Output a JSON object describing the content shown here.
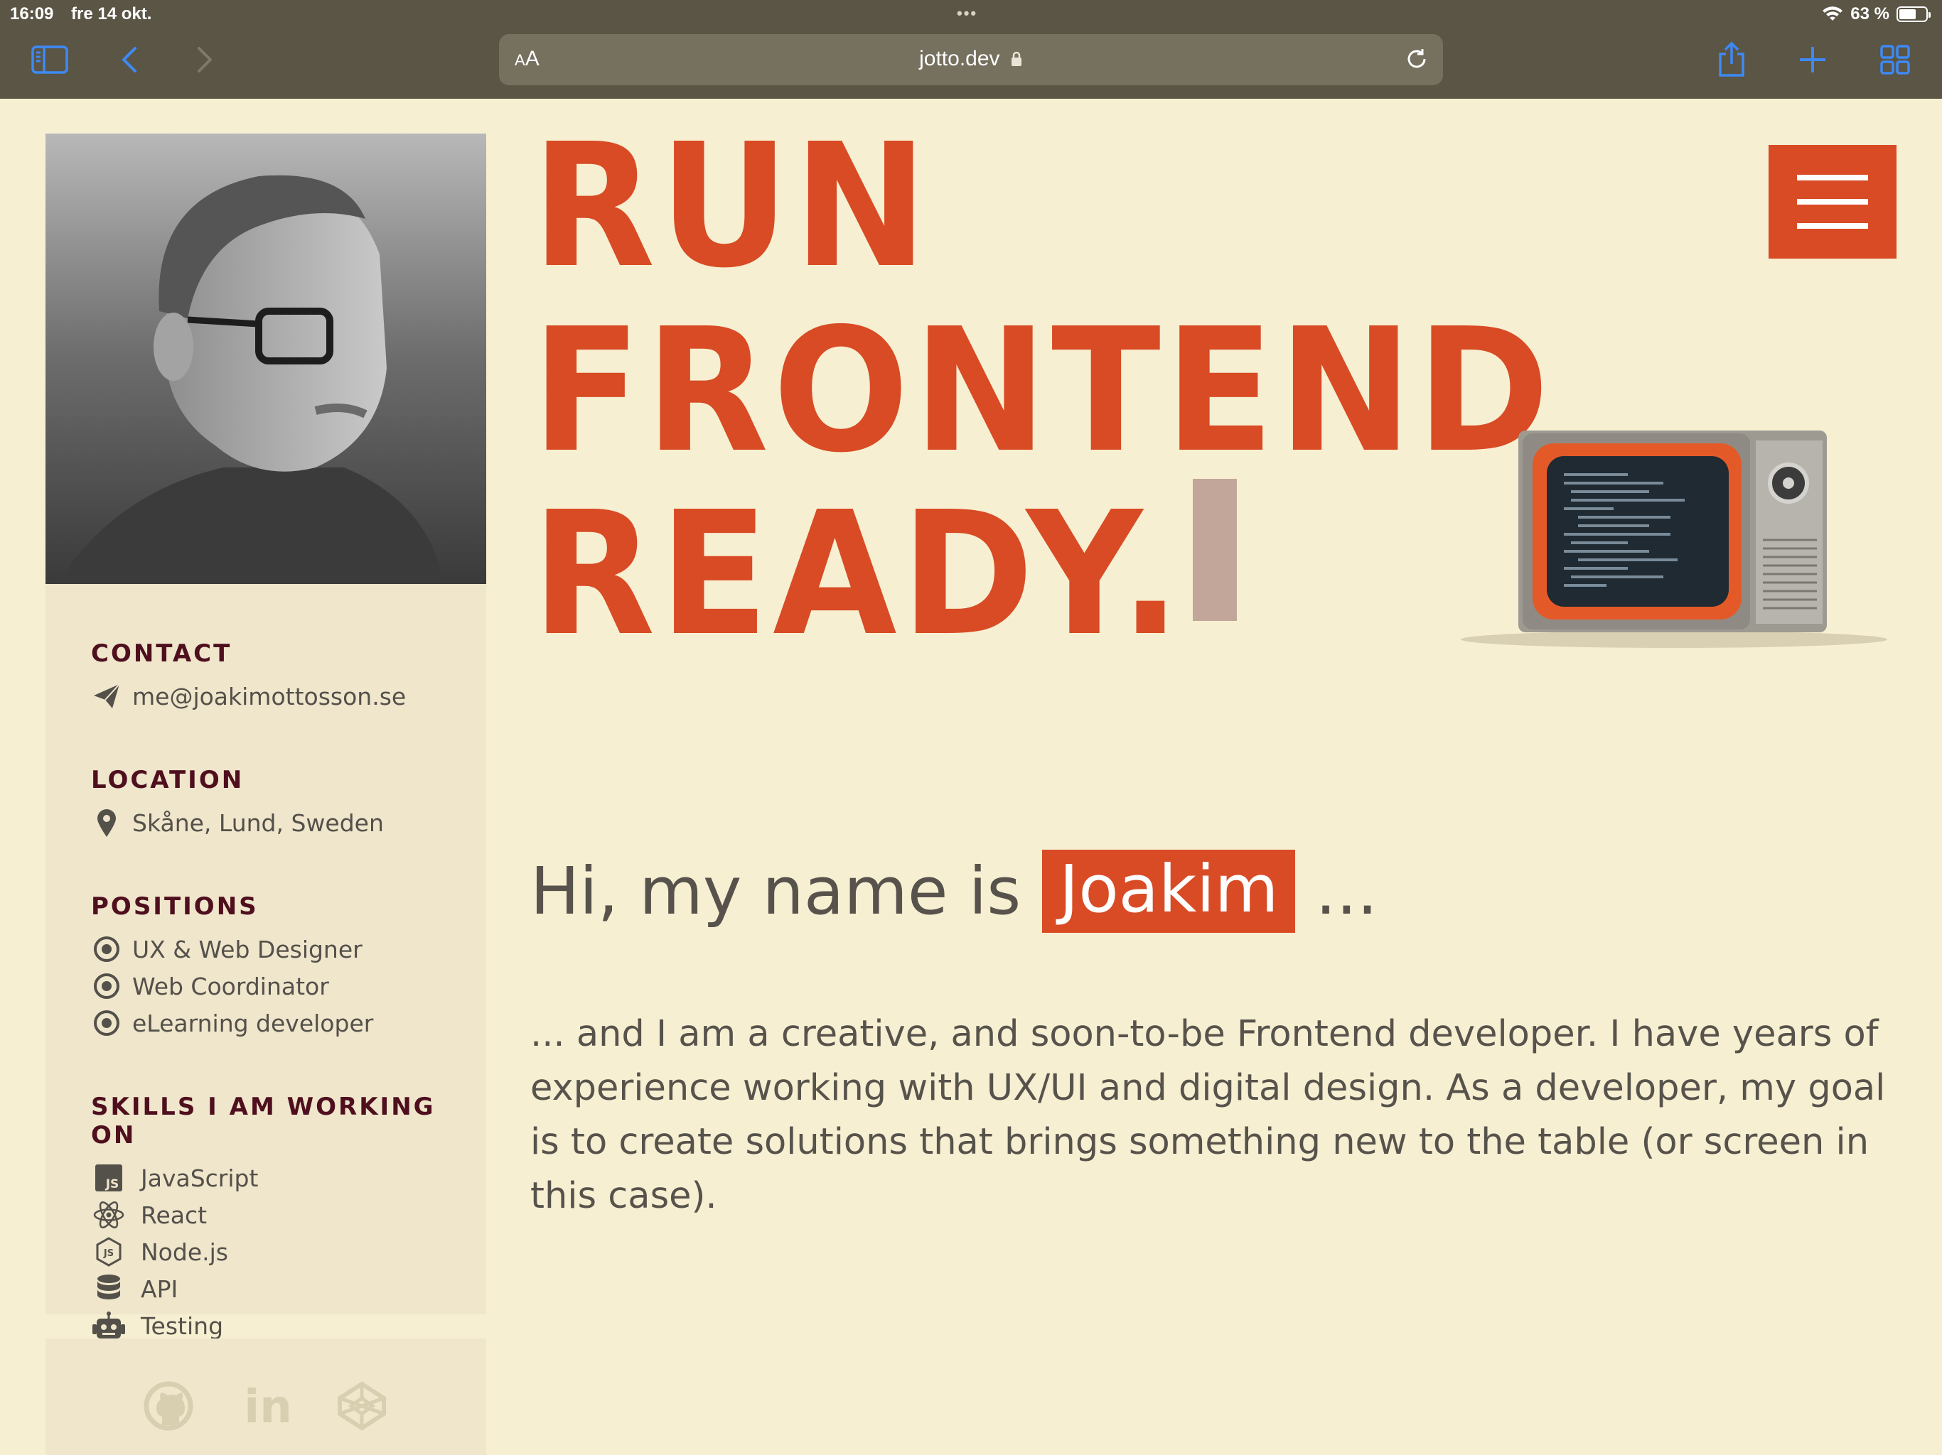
{
  "status_bar": {
    "time": "16:09",
    "date": "fre 14 okt.",
    "dots": "•••",
    "battery": "63 %",
    "battery_level": 0.63
  },
  "browser": {
    "text_size_label_small": "A",
    "text_size_label_large": "A",
    "url": "jotto.dev",
    "accent_color": "#3d8af7"
  },
  "sidebar": {
    "contact": {
      "title": "CONTACT",
      "email": "me@joakimottosson.se",
      "icon": "paper-plane-icon"
    },
    "location": {
      "title": "LOCATION",
      "place": "Skåne, Lund, Sweden",
      "icon": "map-pin-icon"
    },
    "positions": {
      "title": "POSITIONS",
      "items": [
        "UX & Web Designer",
        "Web Coordinator",
        "eLearning developer"
      ]
    },
    "skills": {
      "title": "SKILLS I AM WORKING ON",
      "items": [
        {
          "label": "JavaScript",
          "icon": "js-icon",
          "badge": "JS"
        },
        {
          "label": "React",
          "icon": "react-icon"
        },
        {
          "label": "Node.js",
          "icon": "nodejs-icon"
        },
        {
          "label": "API",
          "icon": "database-icon"
        },
        {
          "label": "Testing",
          "icon": "robot-icon"
        }
      ]
    },
    "social": [
      "github-icon",
      "linkedin-icon",
      "codepen-icon"
    ],
    "linkedin_text": "in"
  },
  "hero": {
    "line1": "RUN",
    "line2": "FRONTEND",
    "line3": "READY.",
    "accent_color": "#d84b25"
  },
  "intro": {
    "greeting": "Hi, my name is",
    "name": "Joakim",
    "ellipsis": "...",
    "about": "... and I am a creative, and soon-to-be Frontend developer. I have years of experience working with UX/UI and digital design. As a developer, my goal is to create solutions that brings something new to the table (or screen in this case)."
  }
}
